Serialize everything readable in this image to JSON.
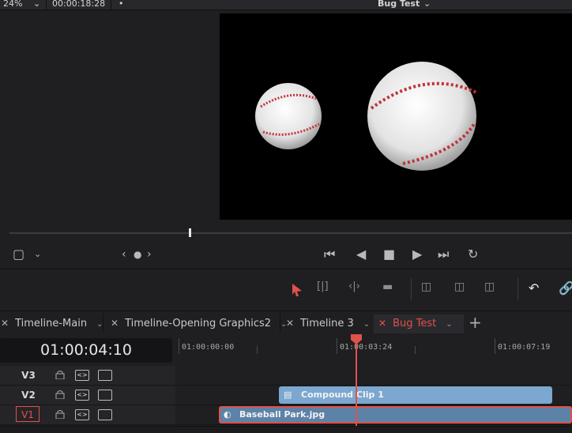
{
  "top_bar": {
    "zoom": "24%",
    "timecode": "00:00:18:28",
    "viewer_title": "Bug Test"
  },
  "transport": {
    "icons": [
      "viewer-options-icon",
      "chevron-down-icon",
      "jog-left-icon",
      "jog-dot-icon",
      "jog-right-icon",
      "go-to-start-icon",
      "play-reverse-icon",
      "stop-icon",
      "play-icon",
      "go-to-end-icon",
      "loop-icon"
    ]
  },
  "edit_toolbar": {
    "icons": [
      "selection-tool-icon",
      "trim-edit-icon",
      "dynamic-trim-icon",
      "blade-edit-icon",
      "insert-clip-icon",
      "overwrite-clip-icon",
      "replace-clip-icon",
      "snapping-icon",
      "linked-selection-icon"
    ]
  },
  "tabs": [
    {
      "label": "Timeline-Main"
    },
    {
      "label": "Timeline-Opening Graphics2"
    },
    {
      "label": "Timeline 3"
    },
    {
      "label": "Bug Test"
    }
  ],
  "timeline": {
    "current_timecode": "01:00:04:10",
    "ruler": [
      "01:00:00:00",
      "01:00:03:24",
      "01:00:07:19"
    ],
    "tracks": [
      {
        "label": "V3"
      },
      {
        "label": "V2"
      },
      {
        "label": "V1"
      }
    ],
    "clips": {
      "compound": "Compound Clip 1",
      "base": "Baseball Park.jpg"
    }
  },
  "colors": {
    "accent": "#e0514a",
    "clip_blue": "#7ba7d1",
    "clip_dark_blue": "#5c82a8"
  }
}
